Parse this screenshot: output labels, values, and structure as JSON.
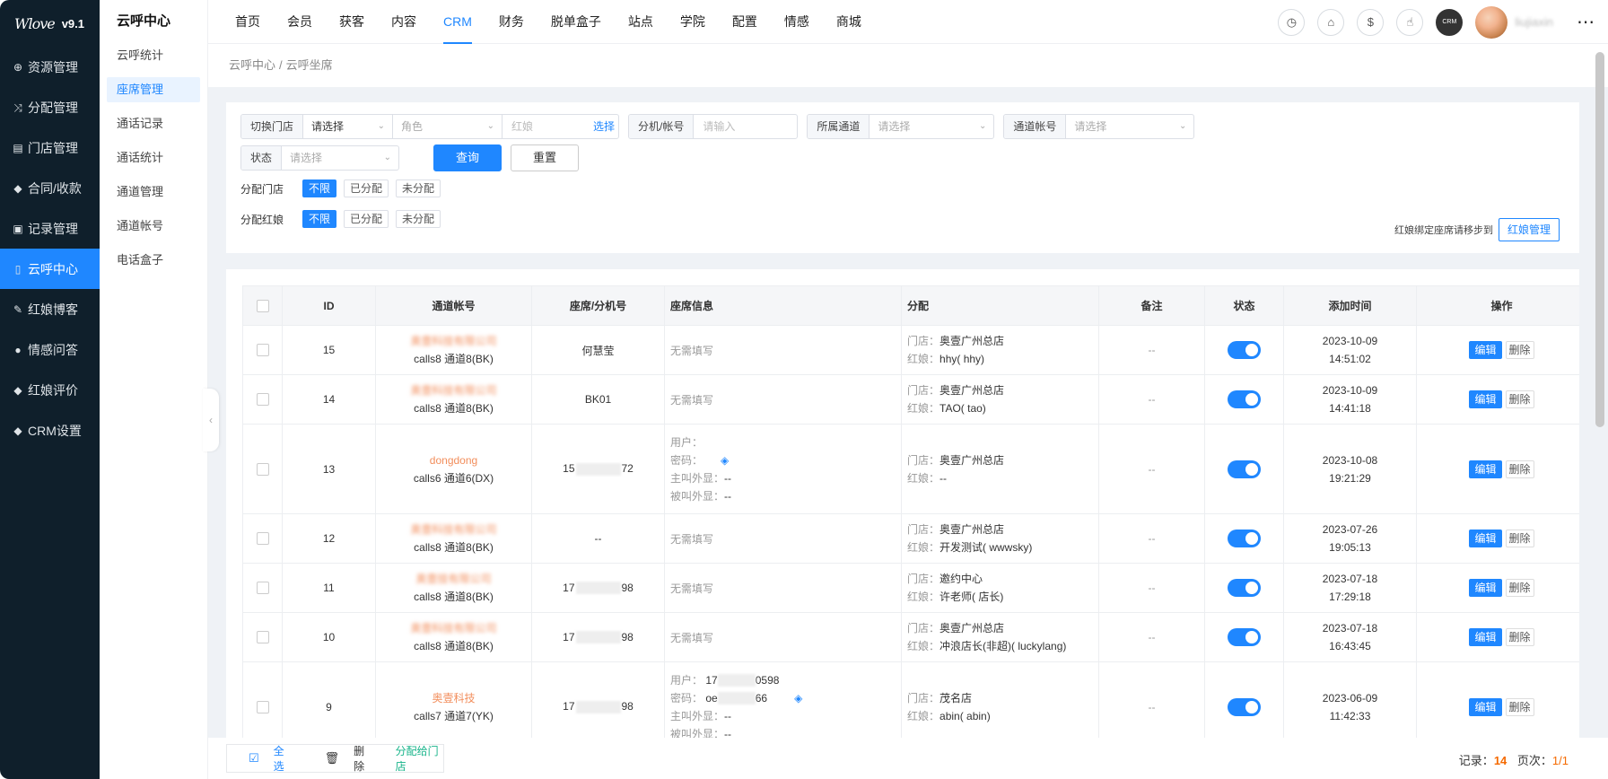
{
  "app": {
    "logo": "Wlove",
    "version": "v9.1"
  },
  "sidebar": {
    "items": [
      {
        "label": "资源管理",
        "icon": "cart-icon"
      },
      {
        "label": "分配管理",
        "icon": "shuffle-icon"
      },
      {
        "label": "门店管理",
        "icon": "store-icon"
      },
      {
        "label": "合同/收款",
        "icon": "badge-icon"
      },
      {
        "label": "记录管理",
        "icon": "record-icon"
      },
      {
        "label": "云呼中心",
        "icon": "phone-icon",
        "active": true
      },
      {
        "label": "红娘博客",
        "icon": "blog-icon"
      },
      {
        "label": "情感问答",
        "icon": "chat-icon"
      },
      {
        "label": "红娘评价",
        "icon": "star-icon"
      },
      {
        "label": "CRM设置",
        "icon": "settings-icon"
      }
    ]
  },
  "subnav": {
    "title": "云呼中心",
    "items": [
      "云呼统计",
      "座席管理",
      "通话记录",
      "通话统计",
      "通道管理",
      "通道帐号",
      "电话盒子"
    ],
    "active_index": 1
  },
  "topnav": {
    "items": [
      "首页",
      "会员",
      "获客",
      "内容",
      "CRM",
      "财务",
      "脱单盒子",
      "站点",
      "学院",
      "配置",
      "情感",
      "商城"
    ],
    "active_index": 4
  },
  "header_icons": [
    "calendar-clock-icon",
    "home-icon",
    "money-bag-icon",
    "hand-icon",
    "crm-badge-icon"
  ],
  "header_crm_badge": "CRM",
  "user": {
    "name": "liujiaxin"
  },
  "breadcrumb": {
    "root": "云呼中心",
    "current": "云呼坐席"
  },
  "filters": {
    "store_label": "切换门店",
    "store_value": "请选择",
    "role_placeholder": "角色",
    "matchmaker_placeholder": "红娘",
    "matchmaker_pick": "选择",
    "ext_label": "分机/帐号",
    "ext_placeholder": "请输入",
    "channel_label": "所属通道",
    "channel_placeholder": "请选择",
    "account_label": "通道帐号",
    "account_placeholder": "请选择",
    "status_label": "状态",
    "status_placeholder": "请选择",
    "search": "查询",
    "reset": "重置",
    "assign_store_label": "分配门店",
    "assign_mm_label": "分配红娘",
    "options": [
      "不限",
      "已分配",
      "未分配"
    ],
    "hint": "红娘绑定座席请移步到",
    "mgr_button": "红娘管理"
  },
  "table": {
    "headers": [
      "ID",
      "通道帐号",
      "座席/分机号",
      "座席信息",
      "分配",
      "备注",
      "状态",
      "添加时间",
      "操作"
    ],
    "labels": {
      "store": "门店：",
      "matchmaker": "红娘：",
      "user": "用户：",
      "password": "密码：",
      "caller": "主叫外显：",
      "callee": "被叫外显：",
      "edit": "编辑",
      "delete": "删除",
      "none": "无需填写"
    },
    "rows": [
      {
        "id": "15",
        "acct_name": "奥壹科技有限公司",
        "acct_channel": "calls8 通道8(BK)",
        "seat": "何慧莹",
        "info": "无需填写",
        "store": "奥壹广州总店",
        "mm": "hhy( hhy)",
        "remark": "--",
        "date": "2023-10-09",
        "time": "14:51:02"
      },
      {
        "id": "14",
        "acct_name": "奥壹科技有限公司",
        "acct_channel": "calls8 通道8(BK)",
        "seat": "BK01",
        "info": "无需填写",
        "store": "奥壹广州总店",
        "mm": "TAO( tao)",
        "remark": "--",
        "date": "2023-10-09",
        "time": "14:41:18"
      },
      {
        "id": "13",
        "acct_name": "dongdong",
        "acct_channel": "calls6 通道6(DX)",
        "seat_pre": "15",
        "seat_post": "72",
        "user": "",
        "password": "",
        "caller": "--",
        "callee": "--",
        "store": "奥壹广州总店",
        "mm": "--",
        "remark": "--",
        "date": "2023-10-08",
        "time": "19:21:29"
      },
      {
        "id": "12",
        "acct_name": "奥壹科技有限公司",
        "acct_channel": "calls8 通道8(BK)",
        "seat": "--",
        "info": "无需填写",
        "store": "奥壹广州总店",
        "mm": "开发测试( wwwsky)",
        "remark": "--",
        "date": "2023-07-26",
        "time": "19:05:13"
      },
      {
        "id": "11",
        "acct_name": "奥壹技有限公司",
        "acct_channel": "calls8 通道8(BK)",
        "seat_pre": "17",
        "seat_post": "98",
        "info": "无需填写",
        "store": "邀约中心",
        "mm": "许老师( 店长)",
        "remark": "--",
        "date": "2023-07-18",
        "time": "17:29:18"
      },
      {
        "id": "10",
        "acct_name": "奥壹科技有限公司",
        "acct_channel": "calls8 通道8(BK)",
        "seat_pre": "17",
        "seat_post": "98",
        "info": "无需填写",
        "store": "奥壹广州总店",
        "mm": "冲浪店长(非超)( luckylang)",
        "remark": "--",
        "date": "2023-07-18",
        "time": "16:43:45"
      },
      {
        "id": "9",
        "acct_name": "奥壹科技",
        "acct_channel": "calls7 通道7(YK)",
        "seat_pre": "17",
        "seat_post": "98",
        "user_pre": "17",
        "user_post": "0598",
        "pwd_pre": "oe",
        "pwd_post": "66",
        "caller": "--",
        "callee": "--",
        "store": "茂名店",
        "mm": "abin( abin)",
        "remark": "--",
        "date": "2023-06-09",
        "time": "11:42:33"
      }
    ]
  },
  "footer": {
    "select_all": "全选",
    "delete": "删除",
    "assign": "分配给门店",
    "record_label": "记录：",
    "record_count": "14",
    "page_label": "页次：",
    "page": "1/1"
  },
  "colors": {
    "primary": "#1f87ff",
    "sidebar_bg": "#0f1f2b",
    "accent_orange": "#f28e5c"
  }
}
